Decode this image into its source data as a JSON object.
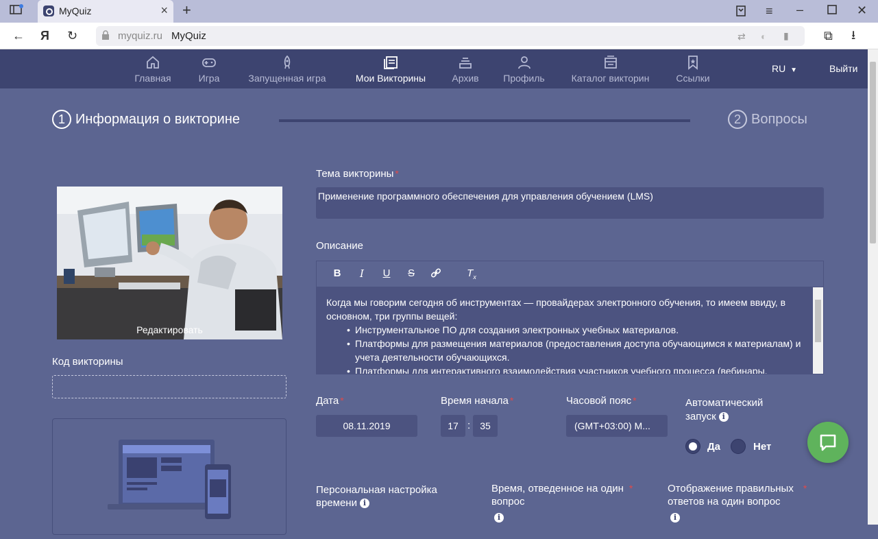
{
  "browser": {
    "tab_title": "MyQuiz",
    "url_domain": "myquiz.ru",
    "url_title": "MyQuiz"
  },
  "nav": {
    "items": [
      {
        "label": "Главная",
        "icon": "home-icon"
      },
      {
        "label": "Игра",
        "icon": "gamepad-icon"
      },
      {
        "label": "Запущенная игра",
        "icon": "rocket-icon"
      },
      {
        "label": "Мои Викторины",
        "icon": "quizzes-icon"
      },
      {
        "label": "Архив",
        "icon": "archive-icon"
      },
      {
        "label": "Профиль",
        "icon": "user-icon"
      },
      {
        "label": "Каталог викторин",
        "icon": "catalog-icon"
      },
      {
        "label": "Ссылки",
        "icon": "bookmark-icon"
      }
    ],
    "active_index": 3,
    "lang": "RU",
    "logout": "Выйти"
  },
  "steps": [
    {
      "num": "1",
      "label": "Информация о викторине"
    },
    {
      "num": "2",
      "label": "Вопросы"
    }
  ],
  "left": {
    "edit_label": "Редактировать",
    "code_label": "Код викторины",
    "code_value": ""
  },
  "form": {
    "topic_label": "Тема викторины",
    "topic_value": "Применение программного обеспечения для управления обучением (LMS)",
    "desc_label": "Описание",
    "desc_intro": "Когда мы говорим сегодня об инструментах — провайдерах электронного обучения, то имеем ввиду, в основном, три группы вещей:",
    "desc_items": [
      "Инструментальное ПО для создания электронных учебных материалов.",
      "Платформы для размещения материалов (предоставления доступа обучающимся к материалам) и учета деятельности обучающихся.",
      "Платформы для интерактивного взаимодействия участников учебного процесса (вебинары,"
    ],
    "date_label": "Дата",
    "date_value": "08.11.2019",
    "time_label": "Время начала",
    "time_hour": "17",
    "time_sep": ":",
    "time_min": "35",
    "tz_label": "Часовой пояс",
    "tz_value": "(GMT+03:00) M...",
    "auto_label_1": "Автоматический",
    "auto_label_2": "запуск",
    "auto_yes": "Да",
    "auto_no": "Нет",
    "personal_label_1": "Персональная настройка",
    "personal_label_2": "времени",
    "time_per_q_label_1": "Время, отведенное на один",
    "time_per_q_label_2": "вопрос",
    "show_correct_label_1": "Отображение правильных",
    "show_correct_label_2": "ответов на один вопрос"
  },
  "colors": {
    "page_bg": "#5c6591",
    "nav_bg": "#3d4470",
    "input_bg": "#4c5380",
    "required": "#e04a4a",
    "chat": "#5fb35c"
  }
}
